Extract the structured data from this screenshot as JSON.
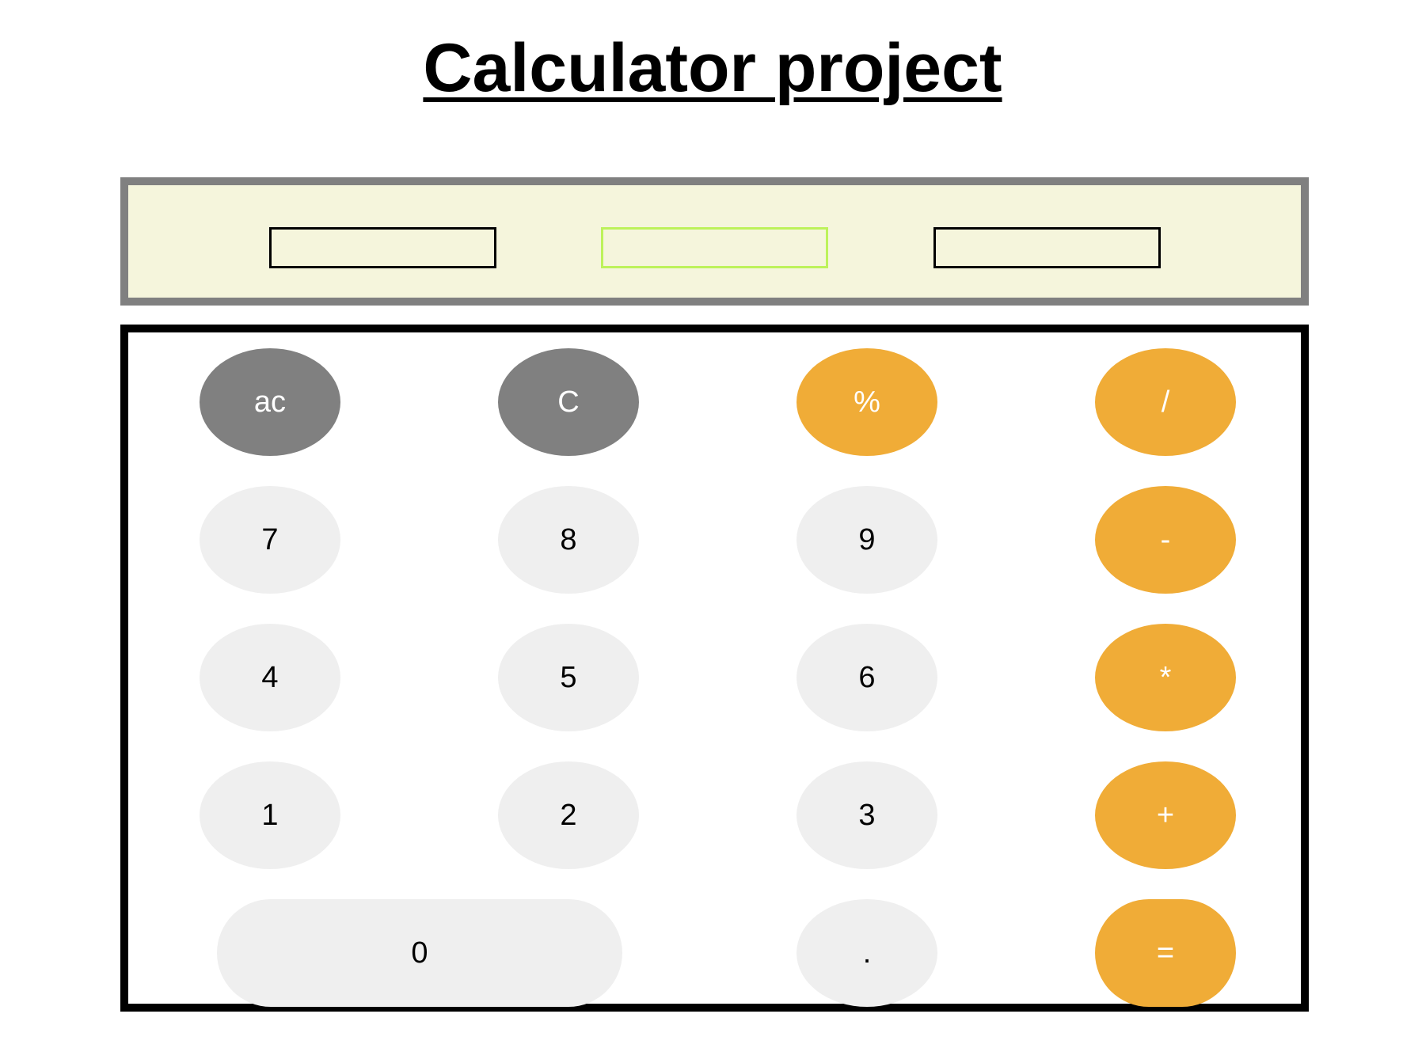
{
  "page": {
    "title": "Calculator project"
  },
  "display": {
    "fields": [
      {
        "value": "",
        "placeholder": ""
      },
      {
        "value": "",
        "placeholder": ""
      },
      {
        "value": "",
        "placeholder": ""
      }
    ]
  },
  "keypad": {
    "row1": [
      "ac",
      "C",
      "%",
      "/"
    ],
    "row2": [
      "7",
      "8",
      "9",
      "-"
    ],
    "row3": [
      "4",
      "5",
      "6",
      "*"
    ],
    "row4": [
      "1",
      "2",
      "3",
      "+"
    ],
    "row5": [
      "0",
      ".",
      "="
    ]
  },
  "colors": {
    "display_background": "#f5f5dc",
    "display_border": "#808080",
    "active_field_border": "#bdf25b",
    "function_key": "#808080",
    "operator_key": "#f0ac37",
    "number_key": "#efefef"
  }
}
